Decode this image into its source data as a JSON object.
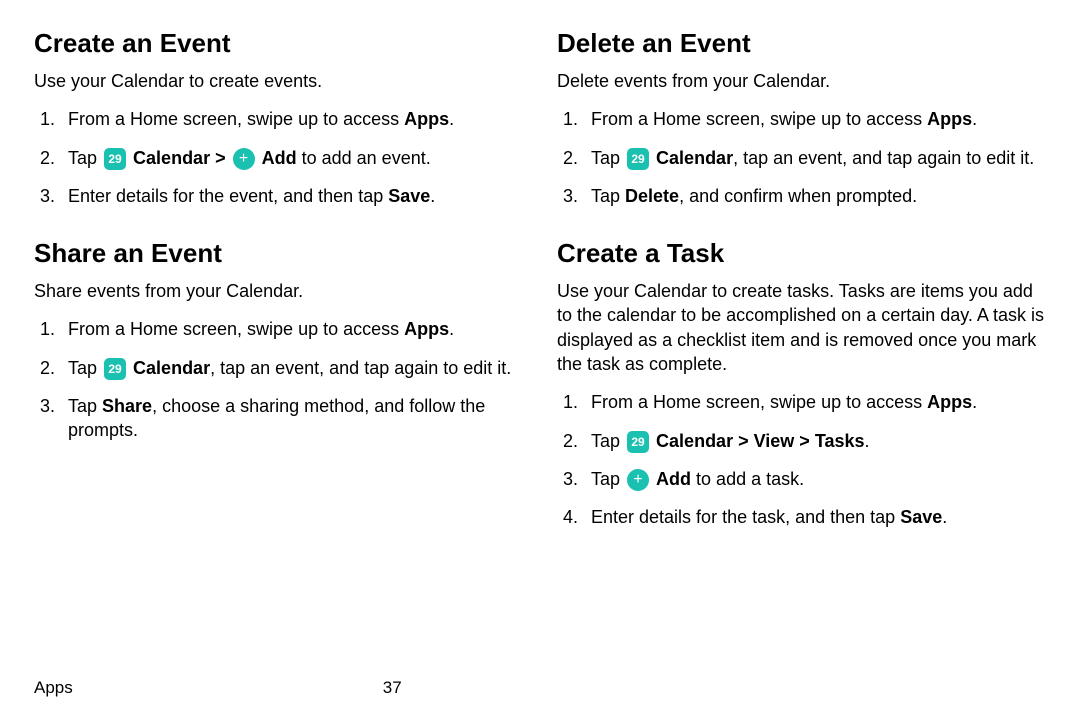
{
  "footer": {
    "section": "Apps",
    "page": "37"
  },
  "left": {
    "s1": {
      "heading": "Create an Event",
      "intro": "Use your Calendar to create events.",
      "step1_pre": "From a Home screen, swipe up to access ",
      "step1_b": "Apps",
      "step1_post": ".",
      "step2_pre": "Tap ",
      "cal_label": "Calendar",
      "sep": " > ",
      "add_label": "Add",
      "step2_post": " to add an event.",
      "step3_pre": "Enter details for the event, and then tap ",
      "step3_b": "Save",
      "step3_post": "."
    },
    "s2": {
      "heading": "Share an Event",
      "intro": "Share events from your Calendar.",
      "step1_pre": "From a Home screen, swipe up to access ",
      "step1_b": "Apps",
      "step1_post": ".",
      "step2_pre": "Tap ",
      "cal_label": "Calendar",
      "step2_post": ", tap an event, and tap again to edit it.",
      "step3_pre": "Tap ",
      "step3_b": "Share",
      "step3_post": ", choose a sharing method, and follow the prompts."
    }
  },
  "right": {
    "s1": {
      "heading": "Delete an Event",
      "intro": "Delete events from your Calendar.",
      "step1_pre": "From a Home screen, swipe up to access ",
      "step1_b": "Apps",
      "step1_post": ".",
      "step2_pre": "Tap ",
      "cal_label": "Calendar",
      "step2_post": ", tap an event, and tap again to edit it.",
      "step3_pre": "Tap ",
      "step3_b": "Delete",
      "step3_post": ", and confirm when prompted."
    },
    "s2": {
      "heading": "Create a Task",
      "intro": "Use your Calendar to create tasks. Tasks are items you add to the calendar to be accomplished on a certain day. A task is displayed as a checklist item and is removed once you mark the task as complete.",
      "step1_pre": "From a Home screen, swipe up to access ",
      "step1_b": "Apps",
      "step1_post": ".",
      "step2_pre": "Tap ",
      "cal_label": "Calendar",
      "sep1": " > ",
      "view_label": "View",
      "sep2": " > ",
      "tasks_label": "Tasks",
      "step2_post": ".",
      "step3_pre": "Tap ",
      "add_label": "Add",
      "step3_post": " to add a task.",
      "step4_pre": "Enter details for the task, and then tap ",
      "step4_b": "Save",
      "step4_post": "."
    }
  },
  "icons": {
    "cal_glyph": "29",
    "plus_glyph": "+"
  }
}
